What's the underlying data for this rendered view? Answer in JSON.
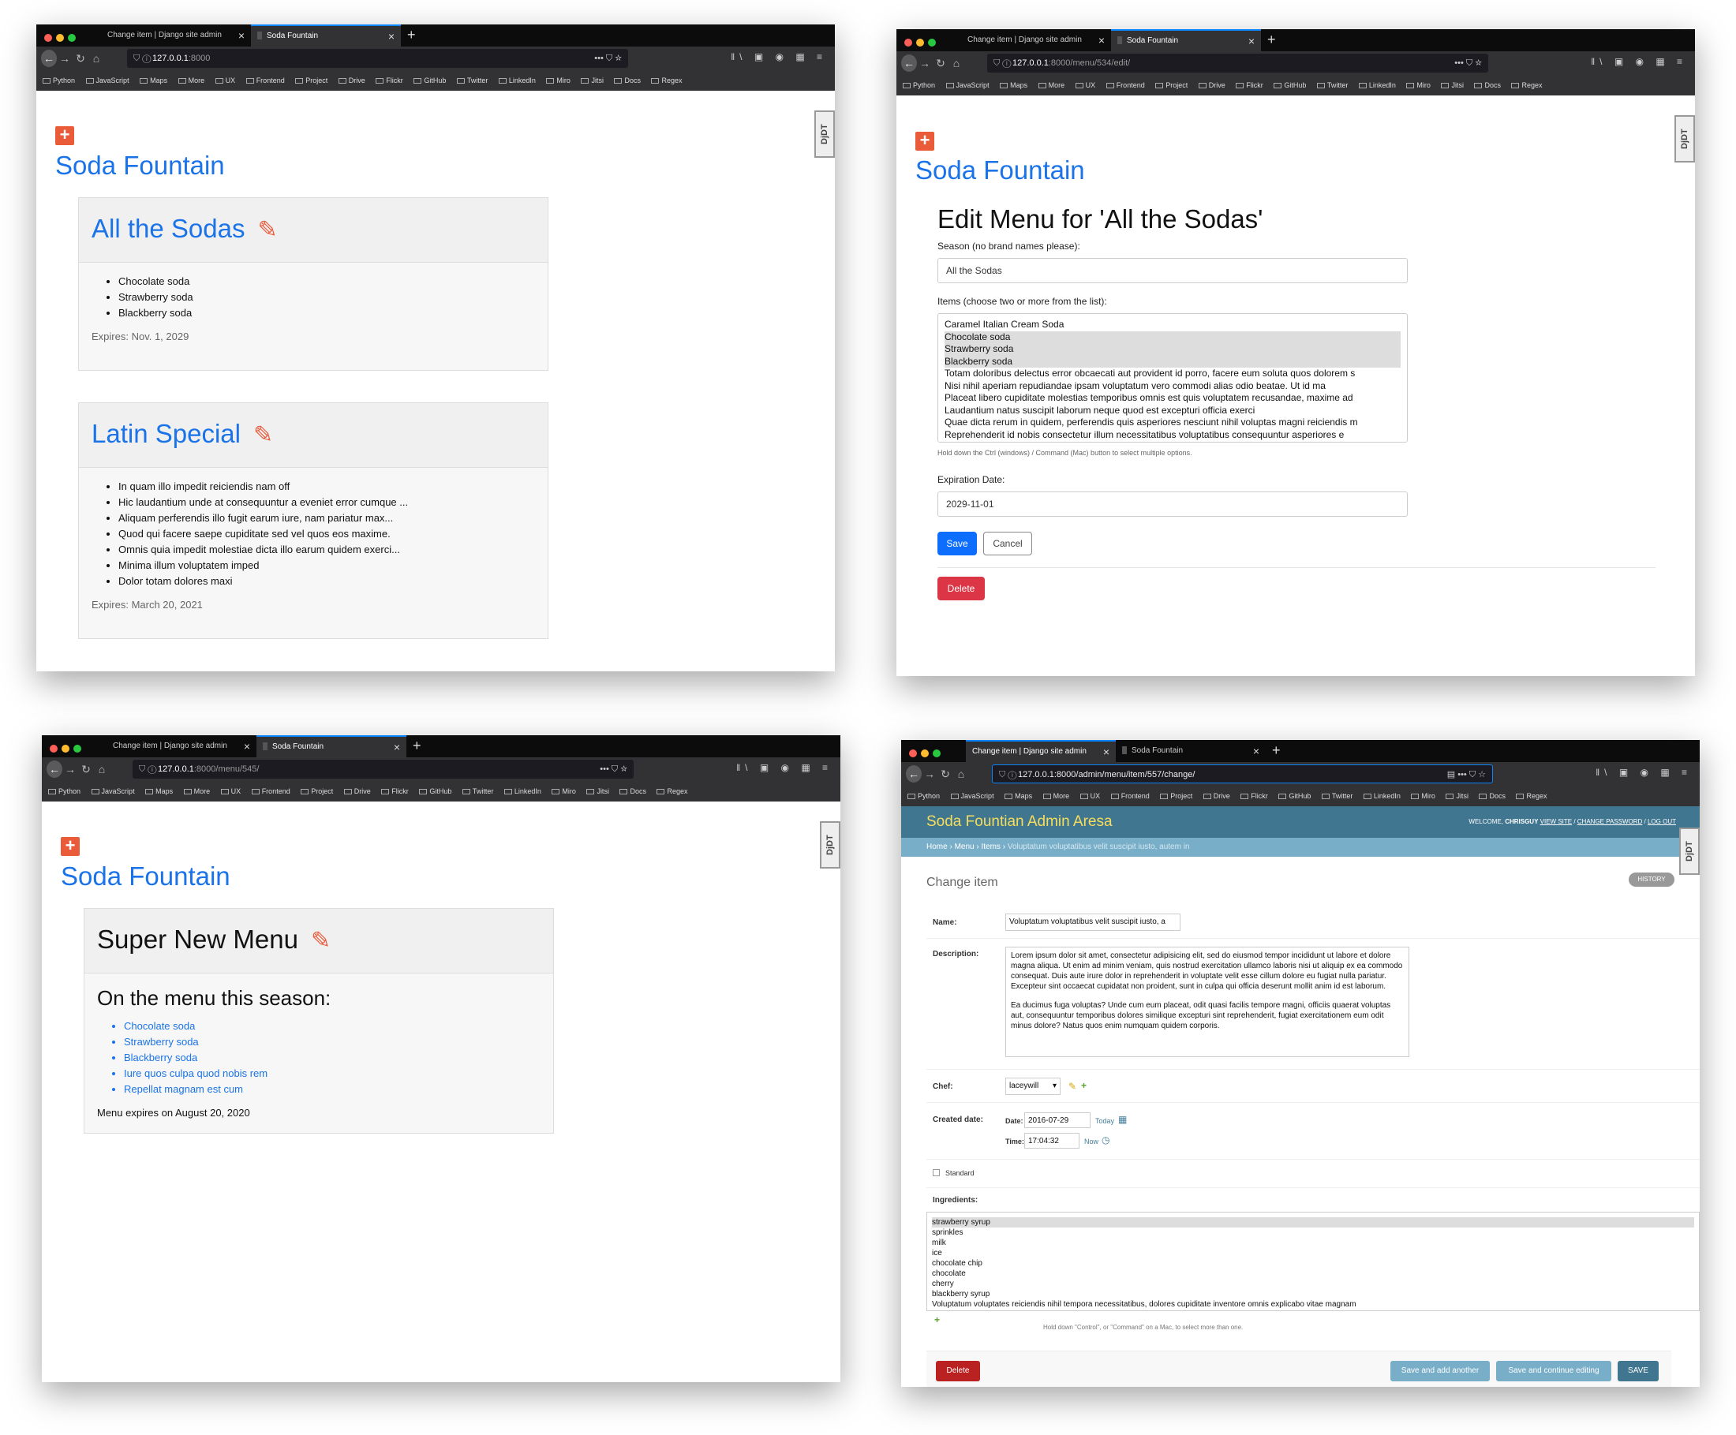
{
  "browser": {
    "tab_admin": "Change item | Django site admin",
    "tab_soda": "Soda Fountain",
    "new_tab": "+",
    "bookmarks": [
      "Python",
      "JavaScript",
      "Maps",
      "More",
      "UX",
      "Frontend",
      "Project",
      "Drive",
      "Flickr",
      "GitHub",
      "Twitter",
      "LinkedIn",
      "Miro",
      "Jitsi",
      "Docs",
      "Regex"
    ],
    "djdt": "DjDT"
  },
  "win1": {
    "url_host": "127.0.0.1",
    "url_rest": ":8000",
    "site_title": "Soda Fountain",
    "menus": [
      {
        "title": "All the Sodas",
        "items": [
          "Chocolate soda",
          "Strawberry soda",
          "Blackberry soda"
        ],
        "expires": "Expires: Nov. 1, 2029"
      },
      {
        "title": "Latin Special",
        "items": [
          "In quam illo impedit reiciendis nam off",
          "Hic laudantium unde at consequuntur a eveniet error cumque ...",
          "Aliquam perferendis illo fugit earum iure, nam pariatur max...",
          "Quod qui facere saepe cupiditate sed vel quos eos maxime.",
          "Omnis quia impedit molestiae dicta illo earum quidem exerci...",
          "Minima illum voluptatem imped",
          "Dolor totam dolores maxi"
        ],
        "expires": "Expires: March 20, 2021"
      }
    ]
  },
  "win2": {
    "url_host": "127.0.0.1",
    "url_rest": ":8000/menu/534/edit/",
    "site_title": "Soda Fountain",
    "heading": "Edit Menu for 'All the Sodas'",
    "season_label": "Season (no brand names please):",
    "season_value": "All the Sodas",
    "items_label": "Items (choose two or more from the list):",
    "items": [
      {
        "text": "Caramel Italian Cream Soda",
        "selected": false
      },
      {
        "text": "Chocolate soda",
        "selected": true
      },
      {
        "text": "Strawberry soda",
        "selected": true
      },
      {
        "text": "Blackberry soda",
        "selected": true
      },
      {
        "text": "Totam doloribus delectus error obcaecati aut provident id porro, facere eum soluta quos dolorem s",
        "selected": false
      },
      {
        "text": "Nisi nihil aperiam repudiandae ipsam voluptatum vero commodi alias odio beatae. Ut id ma",
        "selected": false
      },
      {
        "text": "Placeat libero cupiditate molestias temporibus omnis est quis voluptatem recusandae, maxime ad",
        "selected": false
      },
      {
        "text": "Laudantium natus suscipit laborum neque quod est excepturi officia exerci",
        "selected": false
      },
      {
        "text": "Quae dicta rerum in quidem, perferendis quis asperiores nesciunt nihil voluptas magni reiciendis m",
        "selected": false
      },
      {
        "text": "Reprehenderit id nobis consectetur illum necessitatibus voluptatibus consequuntur asperiores e",
        "selected": false
      }
    ],
    "hint": "Hold down the Ctrl (windows) / Command (Mac) button to select multiple options.",
    "expiration_label": "Expiration Date:",
    "expiration_value": "2029-11-01",
    "save": "Save",
    "cancel": "Cancel",
    "delete": "Delete"
  },
  "win3": {
    "url_host": "127.0.0.1",
    "url_rest": ":8000/menu/545/",
    "site_title": "Soda Fountain",
    "menu_title": "Super New Menu",
    "subheading": "On the menu this season:",
    "items": [
      "Chocolate soda",
      "Strawberry soda",
      "Blackberry soda",
      "Iure quos culpa quod nobis rem",
      "Repellat magnam est cum"
    ],
    "expires": "Menu expires on August 20, 2020"
  },
  "win4": {
    "url": "127.0.0.1:8000/admin/menu/item/557/change/",
    "admin_title": "Soda Fountian Admin Aresa",
    "welcome": "WELCOME,",
    "username": "CHRISGUY",
    "view_site": "VIEW SITE",
    "change_password": "CHANGE PASSWORD",
    "log_out": "LOG OUT",
    "crumb_home": "Home",
    "crumb_menu": "Menu",
    "crumb_items": "Items",
    "crumb_current": "Voluptatum voluptatibus velit suscipit iusto, autem in",
    "change_title": "Change item",
    "history": "HISTORY",
    "name_label": "Name:",
    "name_value": "Voluptatum voluptatibus velit suscipit iusto, a",
    "description_label": "Description:",
    "description_p1": "Lorem ipsum dolor sit amet, consectetur adipisicing elit, sed do eiusmod tempor incididunt ut labore et dolore magna aliqua. Ut enim ad minim veniam, quis nostrud exercitation ullamco laboris nisi ut aliquip ex ea commodo consequat. Duis aute irure dolor in reprehenderit in voluptate velit esse cillum dolore eu fugiat nulla pariatur. Excepteur sint occaecat cupidatat non proident, sunt in culpa qui officia deserunt mollit anim id est laborum.",
    "description_p2": "Ea ducimus fuga voluptas? Unde cum eum placeat, odit quasi facilis tempore magni, officiis quaerat voluptas aut, consequuntur temporibus dolores similique excepturi sint reprehenderit, fugiat exercitationem eum odit minus dolore? Natus quos enim numquam quidem corporis.",
    "chef_label": "Chef:",
    "chef_value": "laceywill",
    "created_label": "Created date:",
    "date_label": "Date:",
    "date_value": "2016-07-29",
    "today": "Today",
    "time_label": "Time:",
    "time_value": "17:04:32",
    "now": "Now",
    "standard_label": "Standard",
    "ingredients_label": "Ingredients:",
    "ingredients": [
      {
        "text": "strawberry syrup",
        "selected": true
      },
      {
        "text": "sprinkles",
        "selected": false
      },
      {
        "text": "milk",
        "selected": false
      },
      {
        "text": "ice",
        "selected": false
      },
      {
        "text": "chocolate chip",
        "selected": false
      },
      {
        "text": "chocolate",
        "selected": false
      },
      {
        "text": "cherry",
        "selected": false
      },
      {
        "text": "blackberry syrup",
        "selected": false
      },
      {
        "text": "Voluptatum voluptates reiciendis nihil tempora necessitatibus, dolores cupiditate inventore omnis explicabo vitae magnam",
        "selected": false
      }
    ],
    "ingredients_hint": "Hold down \"Control\", or \"Command\" on a Mac, to select more than one.",
    "delete": "Delete",
    "save_add": "Save and add another",
    "save_continue": "Save and continue editing",
    "save": "SAVE"
  }
}
